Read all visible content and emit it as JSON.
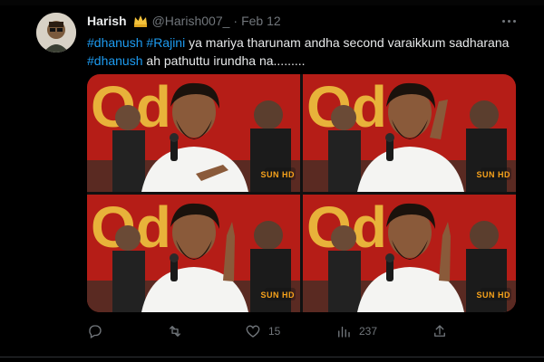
{
  "tweet": {
    "author_name": "Harish",
    "author_handle": "@Harish007_",
    "separator": "·",
    "date": "Feb 12",
    "text_segments": [
      {
        "text": "#dhanush",
        "type": "hashtag"
      },
      {
        "text": "  ",
        "type": "plain"
      },
      {
        "text": "#Rajini",
        "type": "hashtag"
      },
      {
        "text": " ya mariya tharunam andha second varaikkum sadharana ",
        "type": "plain"
      },
      {
        "text": "#dhanush",
        "type": "hashtag"
      },
      {
        "text": " ah pathuttu irundha na.........",
        "type": "plain"
      }
    ]
  },
  "media": {
    "photos": [
      {
        "logo": "SUN HD",
        "pose": "speaking"
      },
      {
        "logo": "SUN HD",
        "pose": "hand-on-head"
      },
      {
        "logo": "SUN HD",
        "pose": "pointing-up"
      },
      {
        "logo": "SUN HD",
        "pose": "pointing-up"
      }
    ],
    "watermark_letters": "Od"
  },
  "actions": {
    "reply": {
      "icon": "reply-icon",
      "count": ""
    },
    "retweet": {
      "icon": "retweet-icon",
      "count": ""
    },
    "like": {
      "icon": "heart-icon",
      "count": "15"
    },
    "views": {
      "icon": "views-icon",
      "count": "237"
    },
    "share": {
      "icon": "share-icon",
      "count": ""
    }
  },
  "colors": {
    "background": "#000000",
    "text": "#e7e9ea",
    "muted": "#71767b",
    "hashtag": "#1d9bf0"
  }
}
